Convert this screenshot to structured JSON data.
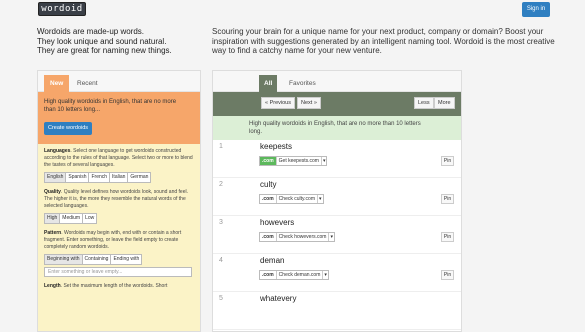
{
  "header": {
    "logo": "wordoid",
    "signin": "Sign in"
  },
  "tagline": [
    "Wordoids are made-up words.",
    "They look unique and sound natural.",
    "They are great for naming new things."
  ],
  "intro": "Scouring your brain for a unique name for your next product, company or domain? Boost your inspiration with suggestions generated by an intelligent naming tool. Wordoid is the most creative way to find a catchy name for your new venture.",
  "left": {
    "tabs": [
      "New",
      "Recent"
    ],
    "quality_text": "High quality wordoids in English, that are no more than 10 letters long...",
    "create_label": "Create wordoids",
    "languages": {
      "title": "Languages",
      "text": ". Select one language to get wordoids constructed according to the rules of that language. Select two or more to blend the tastes of several languages.",
      "options": [
        "English",
        "Spanish",
        "French",
        "Italian",
        "German"
      ]
    },
    "quality": {
      "title": "Quality",
      "text": ". Quality level defines how wordoids look, sound and feel. The higher it is, the more they resemble the natural words of the selected languages.",
      "options": [
        "High",
        "Medium",
        "Low"
      ]
    },
    "pattern": {
      "title": "Pattern",
      "text": ". Wordoids may begin with, end with or contain a short fragment. Enter something, or leave the field empty to create completely random wordoids.",
      "options": [
        "Beginning with",
        "Containing",
        "Ending with"
      ],
      "placeholder": "Enter something or leave empty..."
    },
    "length": {
      "title": "Length",
      "text": ". Set the maximum length of the wordoids. Short"
    }
  },
  "right": {
    "tabs": [
      "All",
      "Favorites"
    ],
    "prev": "« Previous",
    "next": "Next »",
    "less": "Less",
    "more": "More",
    "info": "High quality wordoids in English, that are no more than 10 letters long.",
    "pin_label": "Pin",
    "results": [
      {
        "num": "1",
        "word": "keepests",
        "tld": ".com",
        "check": "Get keepests.com",
        "available": true
      },
      {
        "num": "2",
        "word": "culty",
        "tld": ".com",
        "check": "Check culty.com",
        "available": false
      },
      {
        "num": "3",
        "word": "howevers",
        "tld": ".com",
        "check": "Check howevers.com",
        "available": false
      },
      {
        "num": "4",
        "word": "deman",
        "tld": ".com",
        "check": "Check deman.com",
        "available": false
      },
      {
        "num": "5",
        "word": "whatevery",
        "tld": "",
        "check": "",
        "available": false
      }
    ]
  },
  "colors": {
    "orange": "#f6a66a",
    "yellow": "#fbf3c7",
    "green_bar": "#6c7b65",
    "green_info": "#dcefd6",
    "primary": "#2f7fc1",
    "available": "#5cb85c"
  }
}
